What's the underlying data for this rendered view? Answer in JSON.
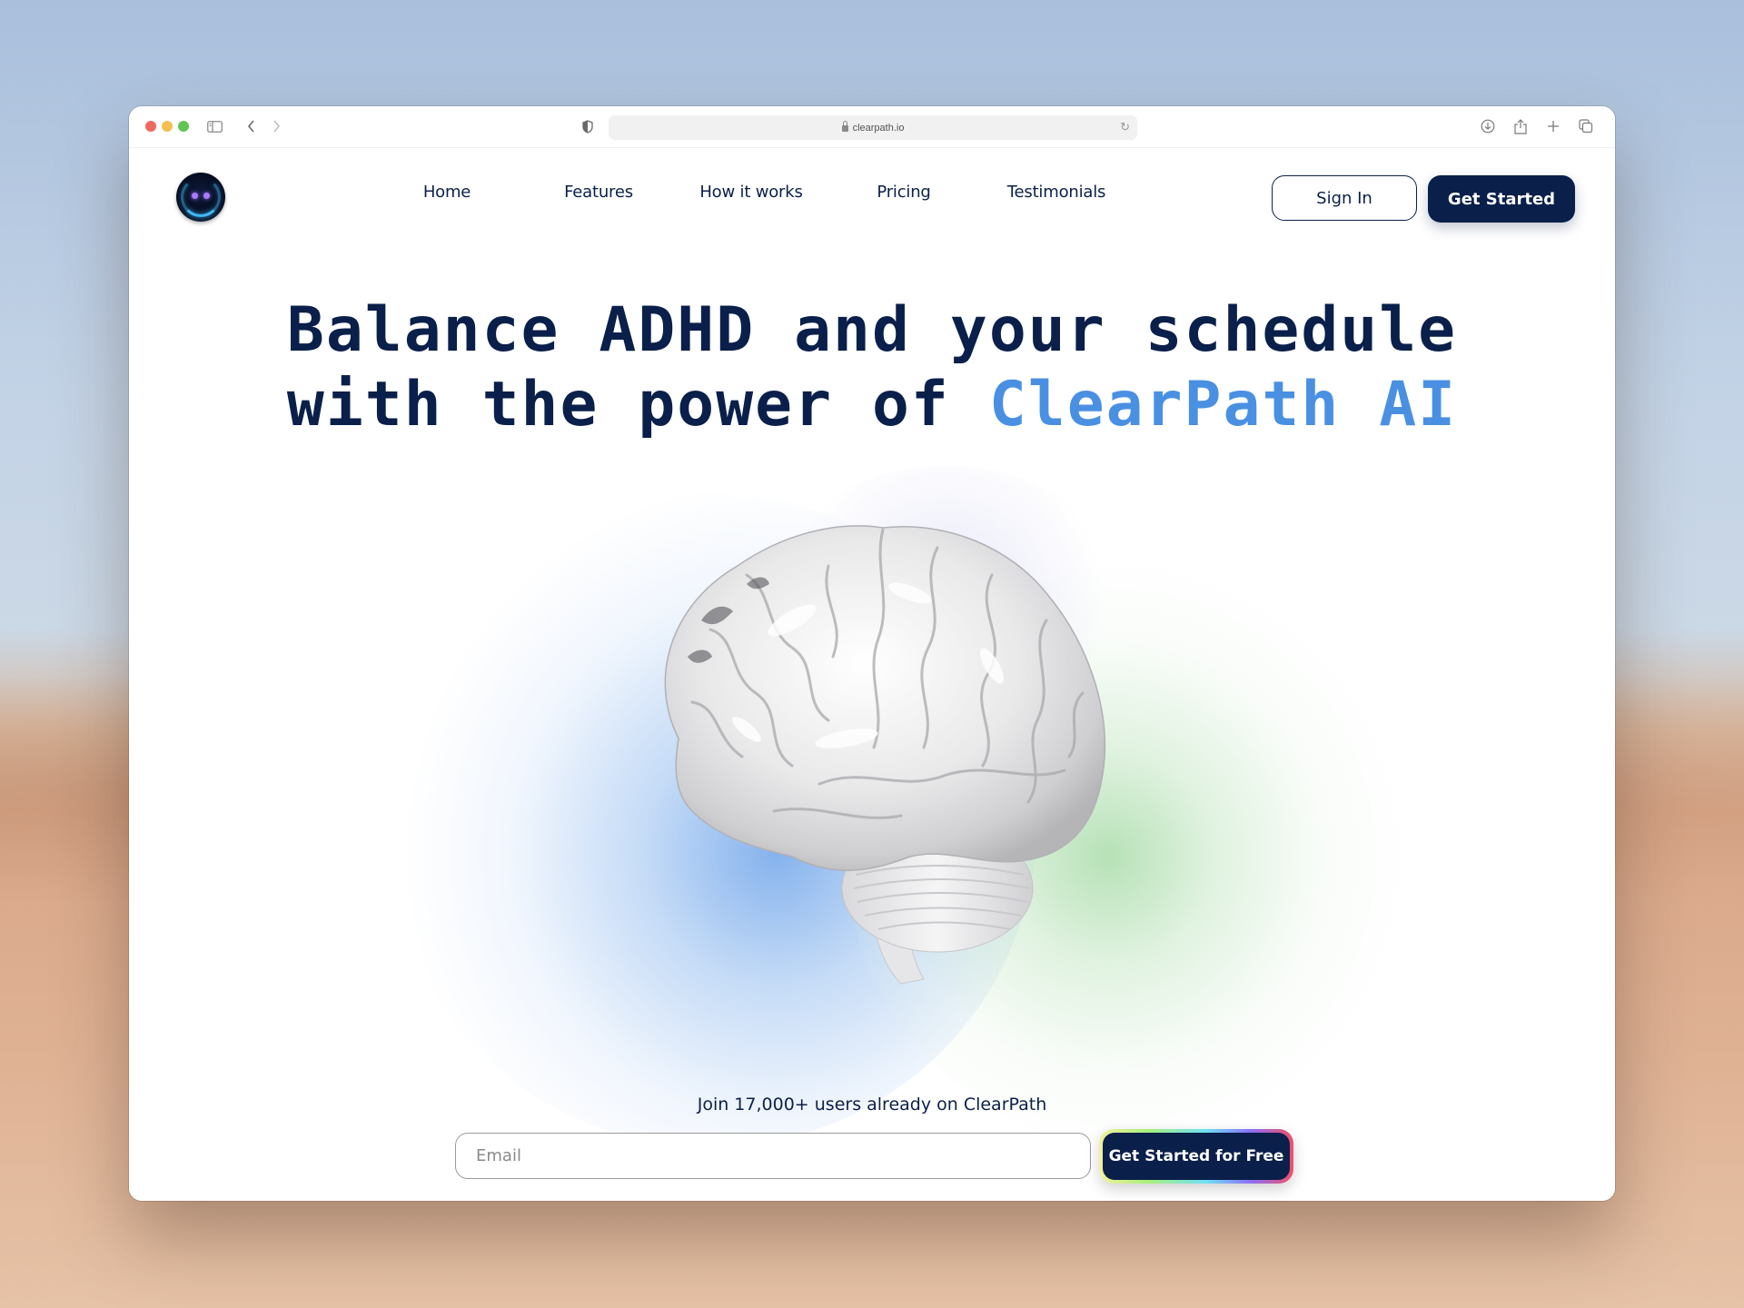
{
  "browser": {
    "url": "clearpath.io",
    "icons": {
      "sidebar": "sidebar-icon",
      "back": "chevron-left-icon",
      "forward": "chevron-right-icon",
      "shield": "shield-icon",
      "lock": "lock-icon",
      "reload": "reload-icon",
      "download": "download-icon",
      "share": "share-icon",
      "new_tab": "plus-icon",
      "tabs": "tabs-overview-icon"
    }
  },
  "header": {
    "logo": "robot-face-logo",
    "nav": [
      {
        "label": "Home"
      },
      {
        "label": "Features"
      },
      {
        "label": "How it works"
      },
      {
        "label": "Pricing"
      },
      {
        "label": "Testimonials"
      }
    ],
    "sign_in_label": "Sign In",
    "get_started_label": "Get Started"
  },
  "hero": {
    "headline_line1": "Balance ADHD and your schedule",
    "headline_line2_prefix": "with the power of ",
    "headline_accent": "ClearPath AI",
    "image": "glossy-brain-illustration",
    "social_proof": "Join 17,000+ users already on ClearPath",
    "email_placeholder": "Email",
    "email_value": "",
    "cta_label": "Get Started for Free"
  },
  "colors": {
    "primary_navy": "#0a1f4a",
    "accent_blue": "#4a90e2",
    "glow_blue": "#78aaeb",
    "glow_green": "#aadcaa"
  }
}
